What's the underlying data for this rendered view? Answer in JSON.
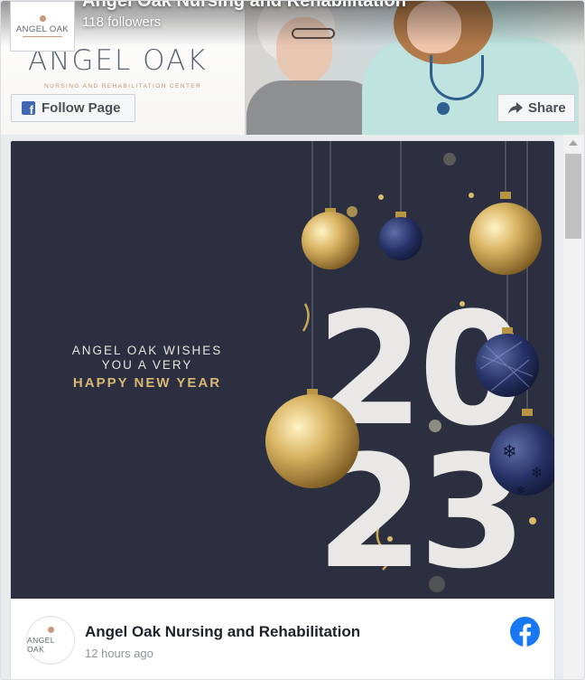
{
  "header": {
    "page_name": "Angel Oak Nursing and Rehabilitation",
    "followers": "118 followers",
    "avatar_text": "ANGEL OAK",
    "banner_logo": "ANGEL OAK",
    "banner_tagline": "NURSING AND REHABILITATION CENTER",
    "follow_label": "Follow Page",
    "share_label": "Share"
  },
  "post": {
    "image_lines": [
      "ANGEL OAK WISHES",
      "YOU A VERY",
      "HAPPY NEW YEAR"
    ],
    "year_top": "20",
    "year_bottom": "23",
    "author": "Angel Oak Nursing and Rehabilitation",
    "timestamp": "12 hours ago",
    "avatar_text": "ANGEL OAK"
  },
  "icons": {
    "follow": "facebook-square-icon",
    "share": "share-arrow-icon",
    "brand": "facebook-circle-icon"
  },
  "colors": {
    "facebook_blue": "#1877f2",
    "image_background": "#2c2f3f",
    "gold": "#d6b773"
  }
}
